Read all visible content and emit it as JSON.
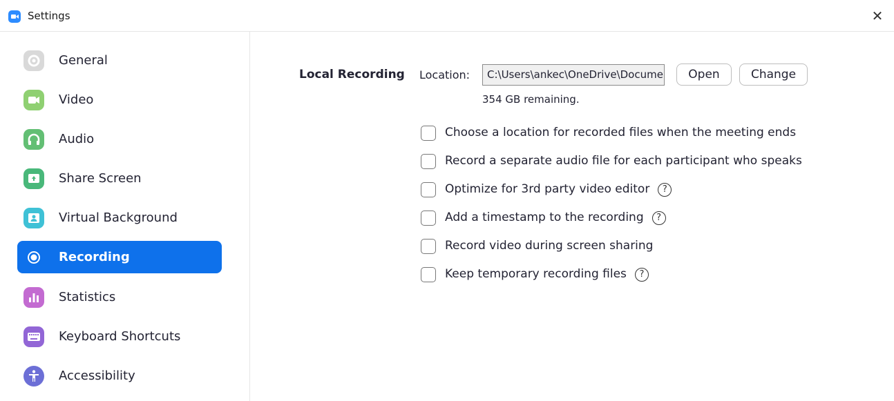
{
  "window": {
    "title": "Settings",
    "close_glyph": "✕"
  },
  "sidebar": {
    "items": [
      {
        "label": "General",
        "icon": "gear-icon",
        "color": "#d9d9d9",
        "active": false
      },
      {
        "label": "Video",
        "icon": "video-camera-icon",
        "color": "#8fd072",
        "active": false
      },
      {
        "label": "Audio",
        "icon": "headphones-icon",
        "color": "#63bf74",
        "active": false
      },
      {
        "label": "Share Screen",
        "icon": "share-screen-icon",
        "color": "#49b87a",
        "active": false
      },
      {
        "label": "Virtual Background",
        "icon": "person-portrait-icon",
        "color": "#3fc1d6",
        "active": false
      },
      {
        "label": "Recording",
        "icon": "record-icon",
        "color": "#0e71eb",
        "active": true
      },
      {
        "label": "Statistics",
        "icon": "bar-chart-icon",
        "color": "#c36bd1",
        "active": false
      },
      {
        "label": "Keyboard Shortcuts",
        "icon": "keyboard-icon",
        "color": "#9266d6",
        "active": false
      },
      {
        "label": "Accessibility",
        "icon": "accessibility-person-icon",
        "color": "#6c6fd6",
        "active": false
      }
    ]
  },
  "main": {
    "section_title": "Local Recording",
    "location_label": "Location:",
    "location_value": "C:\\Users\\ankec\\OneDrive\\Documents\\Zoom",
    "open_button": "Open",
    "change_button": "Change",
    "remaining_text": "354 GB remaining.",
    "options": [
      {
        "label": "Choose a location for recorded files when the meeting ends",
        "checked": false,
        "help": false
      },
      {
        "label": "Record a separate audio file for each participant who speaks",
        "checked": false,
        "help": false
      },
      {
        "label": "Optimize for 3rd party video editor",
        "checked": false,
        "help": true
      },
      {
        "label": "Add a timestamp to the recording",
        "checked": false,
        "help": true
      },
      {
        "label": "Record video during screen sharing",
        "checked": false,
        "help": false
      },
      {
        "label": "Keep temporary recording files",
        "checked": false,
        "help": true
      }
    ],
    "help_glyph": "?"
  }
}
